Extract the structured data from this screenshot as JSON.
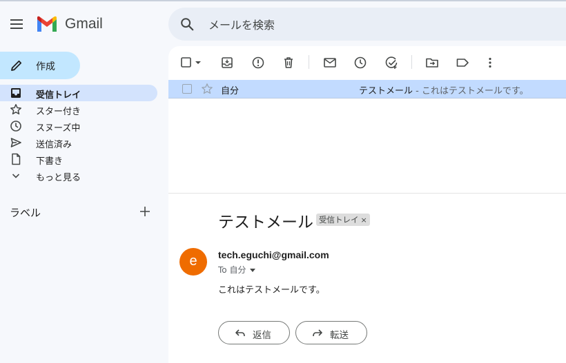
{
  "header": {
    "brand": "Gmail",
    "search_placeholder": "メールを検索"
  },
  "sidebar": {
    "compose_label": "作成",
    "items": [
      {
        "label": "受信トレイ",
        "icon": "inbox-icon",
        "active": true
      },
      {
        "label": "スター付き",
        "icon": "star-icon"
      },
      {
        "label": "スヌーズ中",
        "icon": "clock-icon"
      },
      {
        "label": "送信済み",
        "icon": "send-icon"
      },
      {
        "label": "下書き",
        "icon": "draft-icon"
      },
      {
        "label": "もっと見る",
        "icon": "chevron-down-icon"
      }
    ],
    "labels_title": "ラベル"
  },
  "toolbar": {
    "icons": [
      "select-checkbox-icon",
      "dropdown-arrow-icon",
      "archive-icon",
      "report-spam-icon",
      "delete-icon",
      "mark-unread-icon",
      "snooze-icon",
      "add-to-tasks-icon",
      "move-to-icon",
      "label-icon",
      "more-vert-icon"
    ]
  },
  "mail_list": [
    {
      "sender": "自分",
      "subject": "テストメール",
      "snippet": " - これはテストメールです。"
    }
  ],
  "message": {
    "subject": "テストメール",
    "label_chip": "受信トレイ",
    "label_chip_close": "×",
    "avatar_letter": "e",
    "from": "tech.eguchi@gmail.com",
    "to": "To 自分",
    "body": "これはテストメールです。",
    "reply_label": "返信",
    "forward_label": "転送"
  },
  "colors": {
    "background": "#f6f8fc",
    "compose": "#c2e7ff",
    "active_nav": "#d3e3fd",
    "selected_row": "#c2dbff",
    "avatar": "#ef6c00"
  }
}
